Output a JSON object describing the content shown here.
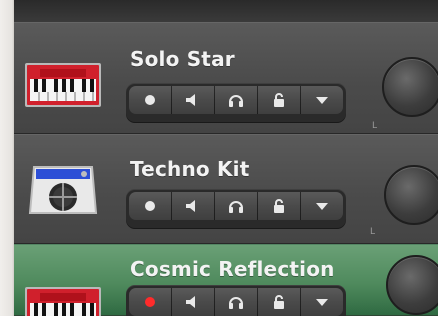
{
  "tracks": [
    {
      "name": "Solo Star",
      "color": "#4b4b4b"
    },
    {
      "name": "Techno Kit",
      "color": "#4b4b4b"
    },
    {
      "name": "Cosmic Reflection",
      "color": "#4f8a5d"
    }
  ],
  "controls": [
    "record-enable-icon",
    "mute-icon",
    "headphones-icon",
    "lock-icon",
    "dropdown-icon"
  ],
  "knob_mark": "L"
}
